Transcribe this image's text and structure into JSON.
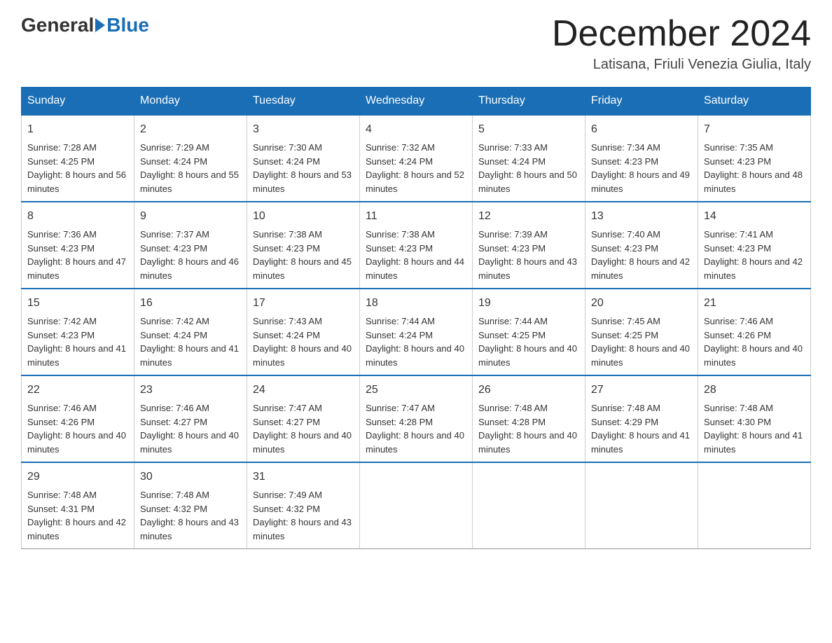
{
  "header": {
    "logo_general": "General",
    "logo_blue": "Blue",
    "month_title": "December 2024",
    "subtitle": "Latisana, Friuli Venezia Giulia, Italy"
  },
  "days_of_week": [
    "Sunday",
    "Monday",
    "Tuesday",
    "Wednesday",
    "Thursday",
    "Friday",
    "Saturday"
  ],
  "weeks": [
    [
      {
        "day": "1",
        "sunrise": "7:28 AM",
        "sunset": "4:25 PM",
        "daylight": "8 hours and 56 minutes."
      },
      {
        "day": "2",
        "sunrise": "7:29 AM",
        "sunset": "4:24 PM",
        "daylight": "8 hours and 55 minutes."
      },
      {
        "day": "3",
        "sunrise": "7:30 AM",
        "sunset": "4:24 PM",
        "daylight": "8 hours and 53 minutes."
      },
      {
        "day": "4",
        "sunrise": "7:32 AM",
        "sunset": "4:24 PM",
        "daylight": "8 hours and 52 minutes."
      },
      {
        "day": "5",
        "sunrise": "7:33 AM",
        "sunset": "4:24 PM",
        "daylight": "8 hours and 50 minutes."
      },
      {
        "day": "6",
        "sunrise": "7:34 AM",
        "sunset": "4:23 PM",
        "daylight": "8 hours and 49 minutes."
      },
      {
        "day": "7",
        "sunrise": "7:35 AM",
        "sunset": "4:23 PM",
        "daylight": "8 hours and 48 minutes."
      }
    ],
    [
      {
        "day": "8",
        "sunrise": "7:36 AM",
        "sunset": "4:23 PM",
        "daylight": "8 hours and 47 minutes."
      },
      {
        "day": "9",
        "sunrise": "7:37 AM",
        "sunset": "4:23 PM",
        "daylight": "8 hours and 46 minutes."
      },
      {
        "day": "10",
        "sunrise": "7:38 AM",
        "sunset": "4:23 PM",
        "daylight": "8 hours and 45 minutes."
      },
      {
        "day": "11",
        "sunrise": "7:38 AM",
        "sunset": "4:23 PM",
        "daylight": "8 hours and 44 minutes."
      },
      {
        "day": "12",
        "sunrise": "7:39 AM",
        "sunset": "4:23 PM",
        "daylight": "8 hours and 43 minutes."
      },
      {
        "day": "13",
        "sunrise": "7:40 AM",
        "sunset": "4:23 PM",
        "daylight": "8 hours and 42 minutes."
      },
      {
        "day": "14",
        "sunrise": "7:41 AM",
        "sunset": "4:23 PM",
        "daylight": "8 hours and 42 minutes."
      }
    ],
    [
      {
        "day": "15",
        "sunrise": "7:42 AM",
        "sunset": "4:23 PM",
        "daylight": "8 hours and 41 minutes."
      },
      {
        "day": "16",
        "sunrise": "7:42 AM",
        "sunset": "4:24 PM",
        "daylight": "8 hours and 41 minutes."
      },
      {
        "day": "17",
        "sunrise": "7:43 AM",
        "sunset": "4:24 PM",
        "daylight": "8 hours and 40 minutes."
      },
      {
        "day": "18",
        "sunrise": "7:44 AM",
        "sunset": "4:24 PM",
        "daylight": "8 hours and 40 minutes."
      },
      {
        "day": "19",
        "sunrise": "7:44 AM",
        "sunset": "4:25 PM",
        "daylight": "8 hours and 40 minutes."
      },
      {
        "day": "20",
        "sunrise": "7:45 AM",
        "sunset": "4:25 PM",
        "daylight": "8 hours and 40 minutes."
      },
      {
        "day": "21",
        "sunrise": "7:46 AM",
        "sunset": "4:26 PM",
        "daylight": "8 hours and 40 minutes."
      }
    ],
    [
      {
        "day": "22",
        "sunrise": "7:46 AM",
        "sunset": "4:26 PM",
        "daylight": "8 hours and 40 minutes."
      },
      {
        "day": "23",
        "sunrise": "7:46 AM",
        "sunset": "4:27 PM",
        "daylight": "8 hours and 40 minutes."
      },
      {
        "day": "24",
        "sunrise": "7:47 AM",
        "sunset": "4:27 PM",
        "daylight": "8 hours and 40 minutes."
      },
      {
        "day": "25",
        "sunrise": "7:47 AM",
        "sunset": "4:28 PM",
        "daylight": "8 hours and 40 minutes."
      },
      {
        "day": "26",
        "sunrise": "7:48 AM",
        "sunset": "4:28 PM",
        "daylight": "8 hours and 40 minutes."
      },
      {
        "day": "27",
        "sunrise": "7:48 AM",
        "sunset": "4:29 PM",
        "daylight": "8 hours and 41 minutes."
      },
      {
        "day": "28",
        "sunrise": "7:48 AM",
        "sunset": "4:30 PM",
        "daylight": "8 hours and 41 minutes."
      }
    ],
    [
      {
        "day": "29",
        "sunrise": "7:48 AM",
        "sunset": "4:31 PM",
        "daylight": "8 hours and 42 minutes."
      },
      {
        "day": "30",
        "sunrise": "7:48 AM",
        "sunset": "4:32 PM",
        "daylight": "8 hours and 43 minutes."
      },
      {
        "day": "31",
        "sunrise": "7:49 AM",
        "sunset": "4:32 PM",
        "daylight": "8 hours and 43 minutes."
      },
      null,
      null,
      null,
      null
    ]
  ]
}
